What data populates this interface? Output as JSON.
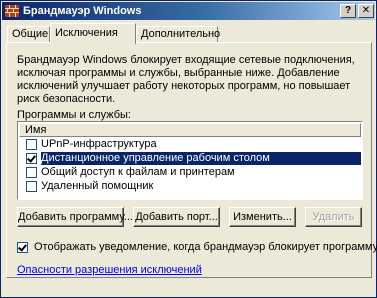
{
  "window": {
    "title": "Брандмауэр Windows",
    "help_glyph": "?",
    "close_glyph": "✕"
  },
  "tabs": [
    {
      "label": "Общие",
      "selected": false
    },
    {
      "label": "Исключения",
      "selected": true
    },
    {
      "label": "Дополнительно",
      "selected": false
    }
  ],
  "description": "Брандмауэр Windows блокирует входящие сетевые подключения, исключая программы и службы, выбранные ниже. Добавление исключений улучшает работу некоторых программ, но повышает риск безопасности.",
  "programs": {
    "label": "Программы и службы:",
    "column_header": "Имя",
    "items": [
      {
        "label": "UPnP-инфраструктура",
        "checked": false,
        "selected": false
      },
      {
        "label": "Дистанционное управление рабочим столом",
        "checked": true,
        "selected": true
      },
      {
        "label": "Общий доступ к файлам и принтерам",
        "checked": false,
        "selected": false
      },
      {
        "label": "Удаленный помощник",
        "checked": false,
        "selected": false
      }
    ]
  },
  "buttons": {
    "add_program": "Добавить программу...",
    "add_port": "Добавить порт...",
    "edit": "Изменить...",
    "delete": "Удалить"
  },
  "notify": {
    "label": "Отображать уведомление, когда брандмауэр блокирует программу",
    "checked": true
  },
  "link": {
    "label": "Опасности разрешения исключений"
  },
  "colors": {
    "title_start": "#0a246a",
    "title_end": "#a6caf0",
    "selection": "#0a246a",
    "link": "#0000ee",
    "face": "#ece9d8"
  }
}
